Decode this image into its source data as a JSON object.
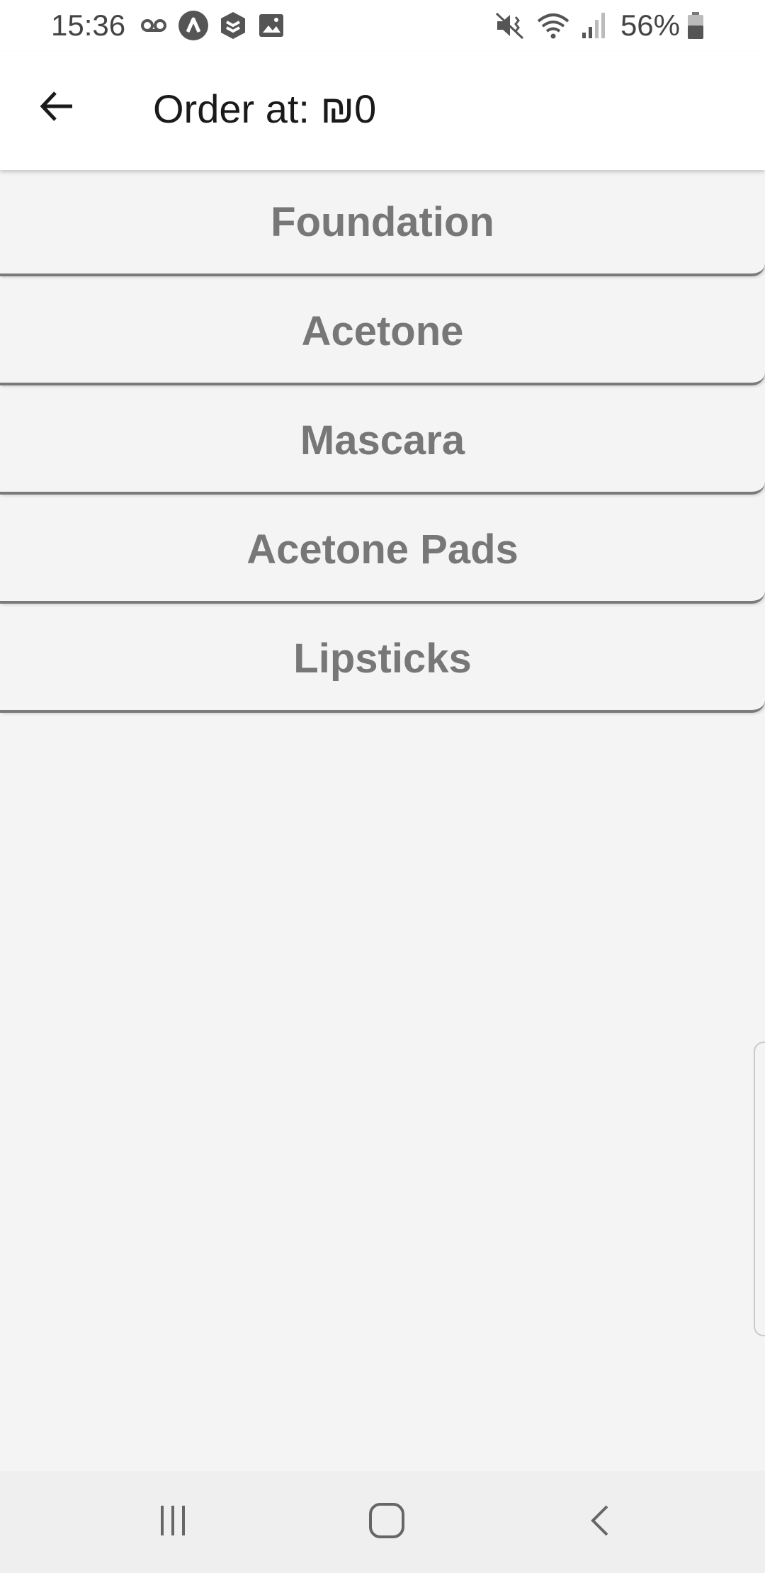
{
  "status_bar": {
    "time": "15:36",
    "battery_percent": "56%",
    "left_icons": [
      "voicemail-icon",
      "app-a-icon",
      "app-stack-icon",
      "image-icon"
    ],
    "right_icons": [
      "mute-vibrate-icon",
      "wifi-icon",
      "signal-icon",
      "battery-icon"
    ]
  },
  "app_bar": {
    "back_icon": "arrow-left-icon",
    "title": "Order at: ₪0"
  },
  "categories": [
    {
      "label": "Foundation"
    },
    {
      "label": "Acetone"
    },
    {
      "label": "Mascara"
    },
    {
      "label": "Acetone Pads"
    },
    {
      "label": "Lipsticks"
    }
  ],
  "nav_bar": {
    "icons": [
      "recent-apps-icon",
      "home-icon",
      "back-icon"
    ]
  },
  "colors": {
    "background": "#f4f4f4",
    "item_text": "#777777",
    "item_border": "#7a7a7a",
    "title_text": "#1a1a1a"
  }
}
